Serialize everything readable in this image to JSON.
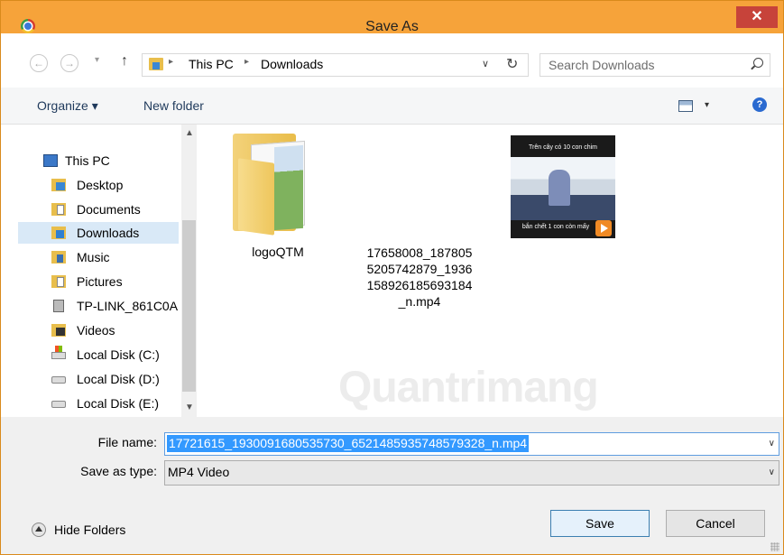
{
  "window": {
    "title": "Save As",
    "close_glyph": "✕"
  },
  "nav": {
    "back_glyph": "←",
    "forward_glyph": "→",
    "recent_glyph": "▾",
    "up_glyph": "↑",
    "breadcrumb": [
      "This PC",
      "Downloads"
    ],
    "sep_glyph": "▸",
    "dropdown_glyph": "∨",
    "refresh_glyph": "↻",
    "search_placeholder": "Search Downloads"
  },
  "toolbar": {
    "organize_label": "Organize ▾",
    "new_folder_label": "New folder",
    "view_drop_glyph": "▾",
    "help_glyph": "?"
  },
  "sidebar": {
    "scroll_up_glyph": "▲",
    "scroll_down_glyph": "▼",
    "items": [
      {
        "label": "This PC",
        "icon": "pc-icon"
      },
      {
        "label": "Desktop",
        "icon": "desktop-icon"
      },
      {
        "label": "Documents",
        "icon": "documents-icon"
      },
      {
        "label": "Downloads",
        "icon": "downloads-icon",
        "selected": true
      },
      {
        "label": "Music",
        "icon": "music-icon"
      },
      {
        "label": "Pictures",
        "icon": "pictures-icon"
      },
      {
        "label": "TP-LINK_861C0A",
        "icon": "network-icon"
      },
      {
        "label": "Videos",
        "icon": "videos-icon"
      },
      {
        "label": "Local Disk (C:)",
        "icon": "system-disk-icon"
      },
      {
        "label": "Local Disk (D:)",
        "icon": "disk-icon"
      },
      {
        "label": "Local Disk (E:)",
        "icon": "disk-icon"
      }
    ]
  },
  "files": [
    {
      "name": "logoQTM",
      "type": "folder"
    },
    {
      "name": "17658008_1878055205742879_1936158926185693184_n.mp4",
      "name_lines": [
        "17658008_187805",
        "5205742879_1936",
        "158926185693184",
        "_n.mp4"
      ],
      "type": "video",
      "thumb_top_text": "Trên cây có 10 con chim",
      "thumb_bottom_text": "bắn chết 1 con còn mấy"
    }
  ],
  "watermark": "Quantrimang",
  "form": {
    "file_name_label": "File name:",
    "file_name_value": "17721615_1930091680535730_6521485935748579328_n.mp4",
    "save_type_label": "Save as type:",
    "save_type_value": "MP4 Video",
    "dropdown_glyph": "∨"
  },
  "footer": {
    "hide_folders_label": "Hide Folders",
    "save_label": "Save",
    "cancel_label": "Cancel"
  },
  "colors": {
    "titlebar": "#f6a33a",
    "close": "#c7433a",
    "selection": "#3399ff"
  }
}
